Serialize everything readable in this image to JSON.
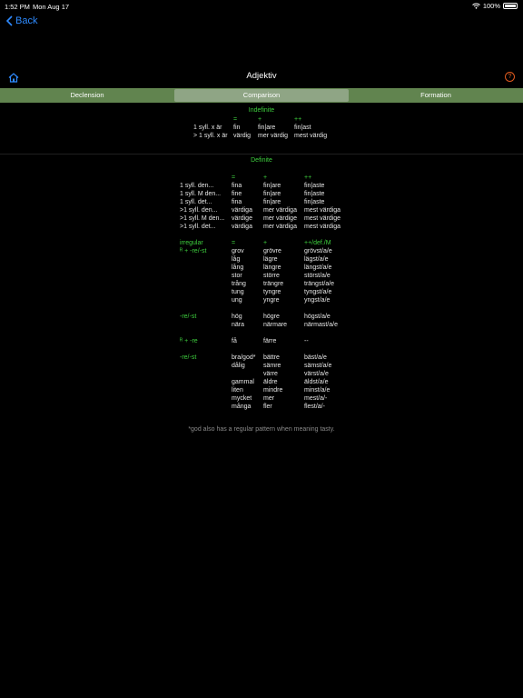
{
  "status": {
    "time": "1:52 PM",
    "date": "Mon Aug 17",
    "battery": "100%"
  },
  "back_label": "Back",
  "title": "Adjektiv",
  "help_label": "?",
  "tabs": [
    "Declension",
    "Comparison",
    "Formation"
  ],
  "indefinite": {
    "heading": "Indefinite",
    "headers": [
      "=",
      "+",
      "++"
    ],
    "rows": [
      {
        "label": "1 syll. x är",
        "c": [
          "fin",
          "fin|are",
          "fin|ast"
        ]
      },
      {
        "label": "> 1 syll. x är",
        "c": [
          "värdig",
          "mer värdig",
          "mest värdig"
        ]
      }
    ]
  },
  "definite": {
    "heading": "Definite",
    "headers": [
      "=",
      "+",
      "++"
    ],
    "rows": [
      {
        "label": "1 syll. den...",
        "c": [
          "fina",
          "fin|are",
          "fin|aste"
        ]
      },
      {
        "label": "1 syll. M den...",
        "c": [
          "fine",
          "fin|are",
          "fin|aste"
        ]
      },
      {
        "label": "1 syll. det...",
        "c": [
          "fina",
          "fin|are",
          "fin|aste"
        ]
      },
      {
        "label": ">1 syll. den...",
        "c": [
          "värdiga",
          "mer värdiga",
          "mest värdiga"
        ]
      },
      {
        "label": ">1 syll. M den...",
        "c": [
          "värdige",
          "mer värdige",
          "mest värdige"
        ]
      },
      {
        "label": ">1 syll. det...",
        "c": [
          "värdiga",
          "mer värdiga",
          "mest värdiga"
        ]
      }
    ]
  },
  "irregular": {
    "label": "irregular",
    "headers": [
      "=",
      "+",
      "++/def./M"
    ],
    "g1_label": "ᴿ + -re/-st",
    "g1": [
      [
        "grov",
        "grövre",
        "grövst/a/e"
      ],
      [
        "låg",
        "lägre",
        "lägst/a/e"
      ],
      [
        "lång",
        "längre",
        "längst/a/e"
      ],
      [
        "stor",
        "större",
        "störst/a/e"
      ],
      [
        "trång",
        "trängre",
        "trängst/a/e"
      ],
      [
        "tung",
        "tyngre",
        "tyngst/a/e"
      ],
      [
        "ung",
        "yngre",
        "yngst/a/e"
      ]
    ],
    "g2_label": "-re/-st",
    "g2": [
      [
        "hög",
        "högre",
        "högst/a/e"
      ],
      [
        "nära",
        "närmare",
        "närmast/a/e"
      ]
    ],
    "g3_label": "ᴿ + -re",
    "g3": [
      [
        "få",
        "färre",
        "--"
      ]
    ],
    "g4_label": "-re/-st",
    "g4": [
      [
        "bra/god*",
        "bättre",
        "bäst/a/e"
      ],
      [
        "dålig",
        "sämre",
        "sämst/a/e"
      ],
      [
        "",
        "värre",
        "värst/a/e"
      ],
      [
        "gammal",
        "äldre",
        "äldst/a/e"
      ],
      [
        "liten",
        "mindre",
        "minst/a/e"
      ],
      [
        "mycket",
        "mer",
        "mest/a/-"
      ],
      [
        "många",
        "fler",
        "flest/a/-"
      ]
    ]
  },
  "note": "*god also has a regular pattern when meaning tasty."
}
